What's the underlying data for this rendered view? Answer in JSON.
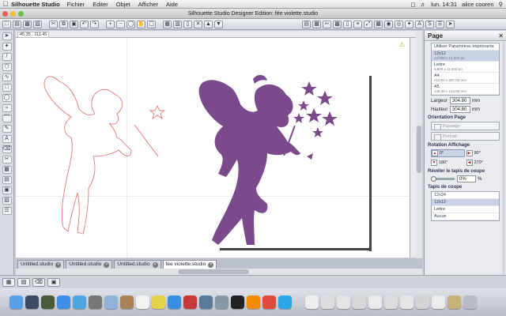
{
  "menubar": {
    "apple_icon": "apple-icon",
    "app_name": "Silhouette Studio",
    "items": [
      "Fichier",
      "Editer",
      "Objet",
      "Afficher",
      "Aide"
    ],
    "clock": "lun. 14:31",
    "user": "alice cooren"
  },
  "window": {
    "title": "Silhouette Studio Designer Edition: fée violette.studio"
  },
  "canvas": {
    "coordinates": "45.35 , 111.45",
    "fairy_color": "#7b4a8c",
    "outline_color": "#e87878"
  },
  "tabs": [
    {
      "label": "Untitled.studio"
    },
    {
      "label": "Untitled.studio"
    },
    {
      "label": "Untitled.studio"
    },
    {
      "label": "fée violette.studio"
    }
  ],
  "panel": {
    "title": "Page",
    "paper_option": "Utiliser Paramètres Imprimante",
    "sizes": [
      {
        "name": "12x12",
        "dims": "12.000 x 12.000 po"
      },
      {
        "name": "Lettre",
        "dims": "8.500 x 11.000 po"
      },
      {
        "name": "A4",
        "dims": "210.00 x 297.00 mm"
      },
      {
        "name": "A5",
        "dims": "148.00 x 210.00 mm"
      }
    ],
    "width_label": "Largeur",
    "width_value": "304.80",
    "height_label": "Hauteur",
    "height_value": "304.80",
    "unit": "mm",
    "orientation_title": "Orientation Page",
    "orient_portrait_land": "Paysage",
    "orient_portrait": "Portrait",
    "rotation_title": "Rotation Affichage",
    "rotations": [
      "0°",
      "90°",
      "180°",
      "270°"
    ],
    "reveal_title": "Révéler le tapis de coupe",
    "reveal_value": "0%",
    "reveal_unit": "%",
    "mat_title": "Tapis de coupe",
    "mats": [
      "12x24",
      "12x12",
      "Lettre",
      "Aucun"
    ]
  }
}
